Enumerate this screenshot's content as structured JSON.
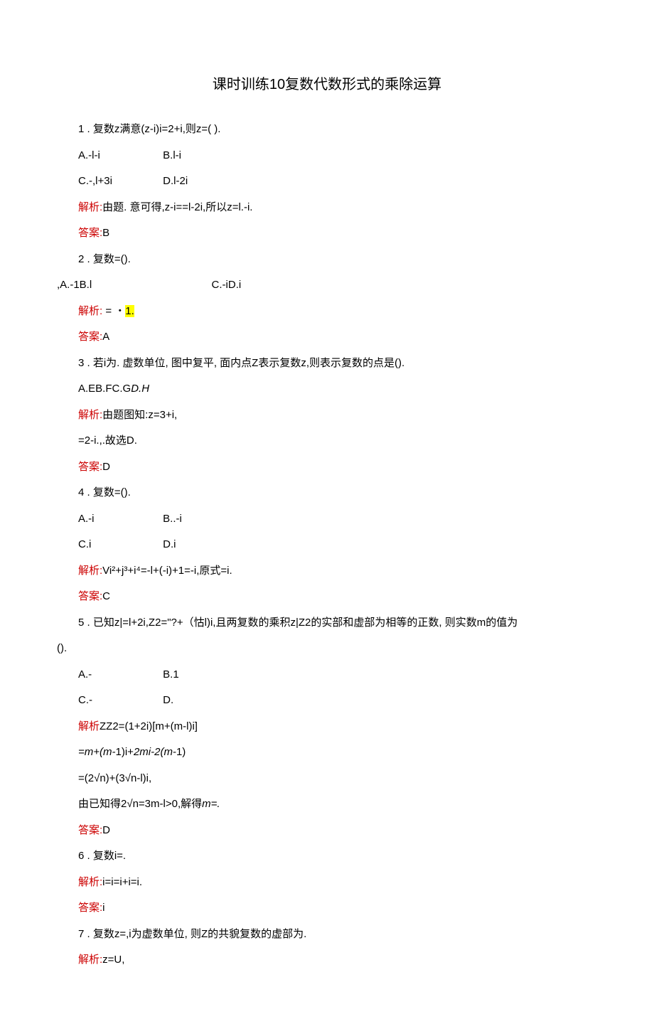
{
  "title": "课时训练10复数代数形式的乘除运算",
  "q1": {
    "stem": "1  . 复数z满意(z-i)i=2+i,则z=(        ).",
    "optA": "A.-l-i",
    "optB": "B.l-i",
    "optC": "C.-,l+3i",
    "optD": "D.l-2i",
    "jiexiLabel": "解析:",
    "jiexiText": "由题. 意可得,z-i==l-2i,所以z=l.-i.",
    "daanLabel": "答案:",
    "daanText": "B"
  },
  "q2": {
    "stem": "2  . 复数=().",
    "opts": ",A.-1B.l",
    "optCD": "C.-iD.i",
    "jiexiLabel": "解析:",
    "jiexiText": " = ・",
    "jiexiHighlight": "1.",
    "daanLabel": "答案:",
    "daanText": "A"
  },
  "q3": {
    "stem": "3  . 若i为. 虚数单位, 图中复平, 面内点Z表示复数z,则表示复数的点是().",
    "opts": "A.EB.FC.G",
    "optsItalic": "D.H",
    "jiexiLabel": "解析:",
    "jiexiText": "由题图知:z=3+i,",
    "line2": "=2-i.,.故选D.",
    "daanLabel": "答案:",
    "daanText": "D"
  },
  "q4": {
    "stem": "4  . 复数=().",
    "optA": "A.-i",
    "optB": "B..-i",
    "optC": "C.i",
    "optD": "D.i",
    "jiexiLabel": "解析:",
    "jiexiText": "Vi²+j³+i⁴=-l+(-i)+1=-i,原式=i.",
    "daanLabel": "答案:",
    "daanText": "C"
  },
  "q5": {
    "stem_a": "5  . 已知z|=l+2i,Z2=\"?+（怙l)i,且两复数的乘积z|Z2的实部和虚部为相等的正数, 则实数m的值为",
    "stem_b": "().",
    "optA": "A.-",
    "optB": "B.1",
    "optC": "C.-",
    "optD": "D.",
    "jiexiLabel": "解析",
    "jiexiText": "ZZ2=(1+2i)[m+(m-l)i]",
    "line2a": "=m+(m-",
    "line2b": "1)i+",
    "line2c": "2mi-2(m-",
    "line2d": "1)",
    "line3": "=(2√n)+(3√n-l)i,",
    "line4a": "由已知得2√n=3m-l>0,解得",
    "line4b": "m=.",
    "daanLabel": "答案:",
    "daanText": "D"
  },
  "q6": {
    "stem": "6  . 复数i=.",
    "jiexiLabel": "解析:",
    "jiexiText": "i=i=i+i=i.",
    "daanLabel": "答案:",
    "daanText": "i"
  },
  "q7": {
    "stem": "7  . 复数z=,i为虚数单位, 则Z的共貌复数的虚部为.",
    "jiexiLabel": "解析:",
    "jiexiText": "z=U,"
  }
}
